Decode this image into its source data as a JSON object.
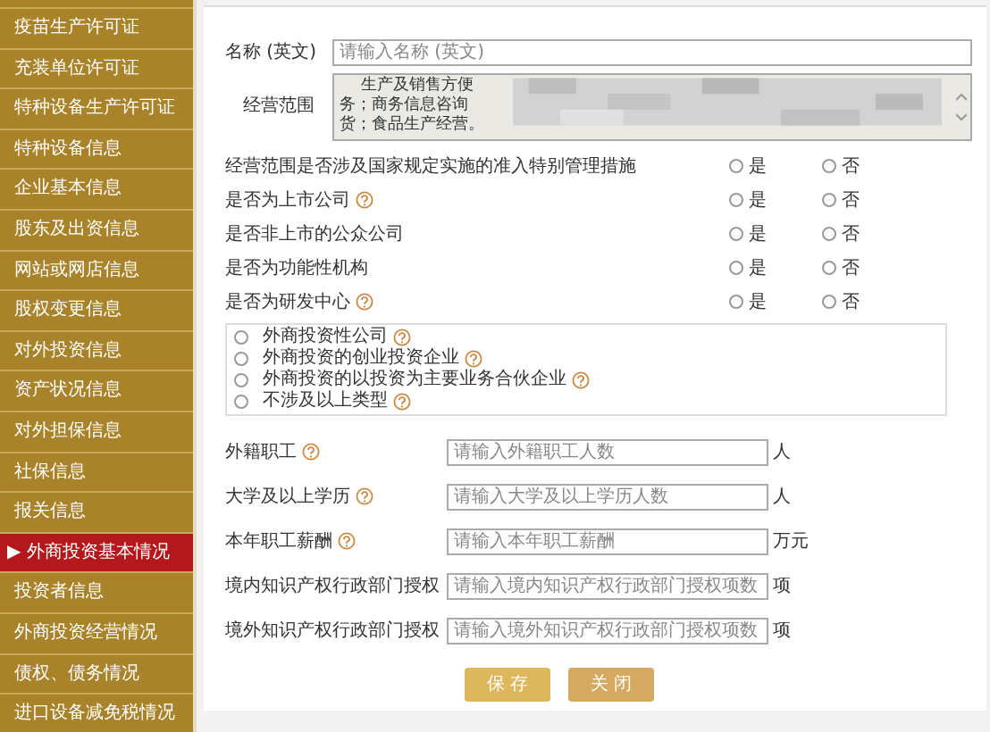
{
  "sidebar": {
    "items": [
      {
        "label": "疫苗生产许可证",
        "selected": false
      },
      {
        "label": "充装单位许可证",
        "selected": false
      },
      {
        "label": "特种设备生产许可证",
        "selected": false
      },
      {
        "label": "特种设备信息",
        "selected": false
      },
      {
        "label": "企业基本信息",
        "selected": false
      },
      {
        "label": "股东及出资信息",
        "selected": false
      },
      {
        "label": "网站或网店信息",
        "selected": false
      },
      {
        "label": "股权变更信息",
        "selected": false
      },
      {
        "label": "对外投资信息",
        "selected": false
      },
      {
        "label": "资产状况信息",
        "selected": false
      },
      {
        "label": "对外担保信息",
        "selected": false
      },
      {
        "label": "社保信息",
        "selected": false
      },
      {
        "label": "报关信息",
        "selected": false
      },
      {
        "label": "外商投资基本情况",
        "selected": true,
        "marker": "▶"
      },
      {
        "label": "投资者信息",
        "selected": false
      },
      {
        "label": "外商投资经营情况",
        "selected": false
      },
      {
        "label": "债权、债务情况",
        "selected": false
      },
      {
        "label": "进口设备减免税情况",
        "selected": false
      }
    ]
  },
  "form": {
    "name_en": {
      "label": "名称 (英文)",
      "placeholder": "请输入名称 (英文)"
    },
    "scope": {
      "label": "经营范围",
      "lines": [
        "生产及销售方便",
        "务；商务信息咨询",
        "货；食品生产经营。"
      ]
    },
    "questions": [
      {
        "label": "经营范围是否涉及国家规定实施的准入特别管理措施",
        "help": false,
        "options": [
          {
            "label": "是",
            "selected": false
          },
          {
            "label": "否",
            "selected": false
          }
        ]
      },
      {
        "label": "是否为上市公司",
        "help": true,
        "options": [
          {
            "label": "是",
            "selected": false
          },
          {
            "label": "否",
            "selected": false
          }
        ]
      },
      {
        "label": "是否非上市的公众公司",
        "help": false,
        "options": [
          {
            "label": "是",
            "selected": false
          },
          {
            "label": "否",
            "selected": false
          }
        ]
      },
      {
        "label": "是否为功能性机构",
        "help": false,
        "options": [
          {
            "label": "是",
            "selected": false
          },
          {
            "label": "否",
            "selected": false
          }
        ]
      },
      {
        "label": "是否为研发中心",
        "help": true,
        "options": [
          {
            "label": "是",
            "selected": false
          },
          {
            "label": "否",
            "selected": false
          }
        ]
      }
    ],
    "investment_types": [
      {
        "label": "外商投资性公司",
        "help": true,
        "selected": false
      },
      {
        "label": "外商投资的创业投资企业",
        "help": true,
        "selected": false
      },
      {
        "label": "外商投资的以投资为主要业务合伙企业",
        "help": true,
        "selected": false
      },
      {
        "label": "不涉及以上类型",
        "help": true,
        "selected": false
      }
    ],
    "numbers": [
      {
        "label": "外籍职工",
        "help": true,
        "placeholder": "请输入外籍职工人数",
        "unit": "人"
      },
      {
        "label": "大学及以上学历",
        "help": true,
        "placeholder": "请输入大学及以上学历人数",
        "unit": "人"
      },
      {
        "label": "本年职工薪酬",
        "help": true,
        "placeholder": "请输入本年职工薪酬",
        "unit": "万元"
      },
      {
        "label": "境内知识产权行政部门授权",
        "help": false,
        "placeholder": "请输入境内知识产权行政部门授权项数",
        "unit": "项"
      },
      {
        "label": "境外知识产权行政部门授权",
        "help": false,
        "placeholder": "请输入境外知识产权行政部门授权项数",
        "unit": "项"
      }
    ],
    "buttons": [
      "保 存",
      "关 闭"
    ]
  }
}
